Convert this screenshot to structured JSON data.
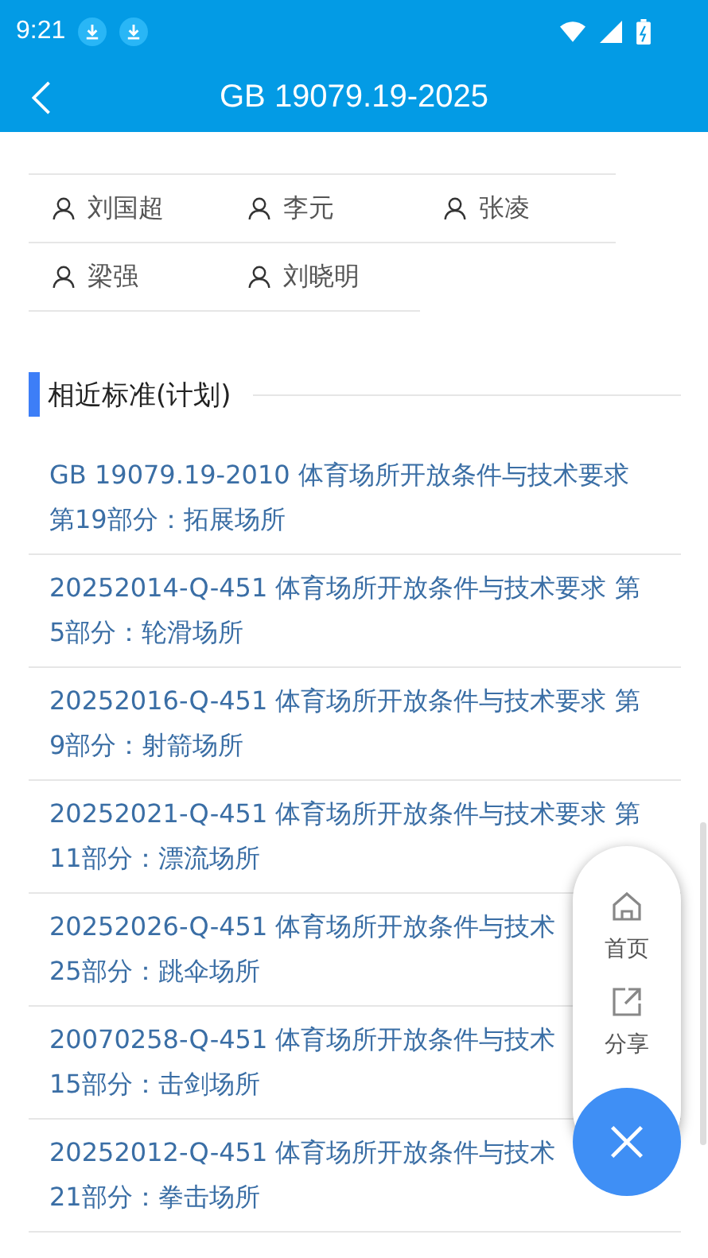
{
  "status_bar": {
    "time": "9:21"
  },
  "header": {
    "title": "GB 19079.19-2025"
  },
  "people": [
    {
      "name": "刘国超"
    },
    {
      "name": "李元"
    },
    {
      "name": "张凌"
    },
    {
      "name": "梁强"
    },
    {
      "name": "刘晓明"
    }
  ],
  "section": {
    "title": "相近标准(计划)"
  },
  "related_standards": [
    {
      "lines": [
        "GB 19079.19-2010 体育场所开放条件与技术要求",
        "第19部分：拓展场所"
      ]
    },
    {
      "lines": [
        "20252014-Q-451 体育场所开放条件与技术要求 第",
        "5部分：轮滑场所"
      ]
    },
    {
      "lines": [
        "20252016-Q-451 体育场所开放条件与技术要求 第",
        "9部分：射箭场所"
      ]
    },
    {
      "lines": [
        "20252021-Q-451 体育场所开放条件与技术要求 第",
        "11部分：漂流场所"
      ]
    },
    {
      "lines": [
        "20252026-Q-451 体育场所开放条件与技术",
        "25部分：跳伞场所"
      ]
    },
    {
      "lines": [
        "20070258-Q-451 体育场所开放条件与技术",
        "15部分：击剑场所"
      ]
    },
    {
      "lines": [
        "20252012-Q-451 体育场所开放条件与技术",
        "21部分：拳击场所"
      ]
    }
  ],
  "float_menu": {
    "items": [
      {
        "kind": "home",
        "label": "首页"
      },
      {
        "kind": "share",
        "label": "分享"
      }
    ]
  }
}
